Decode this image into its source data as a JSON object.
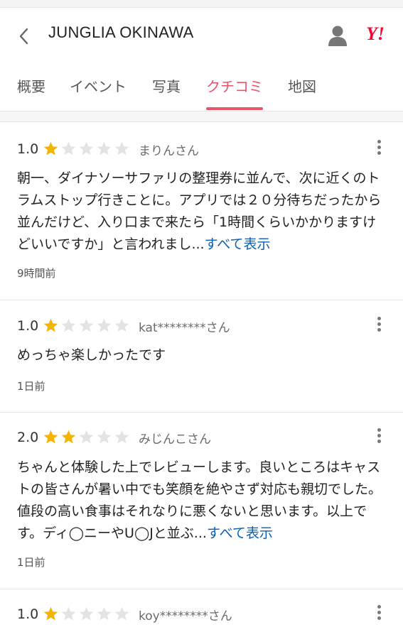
{
  "header": {
    "title": "JUNGLIA OKINAWA",
    "logo_text": "Y!"
  },
  "tabs": [
    {
      "label": "概要",
      "active": false
    },
    {
      "label": "イベント",
      "active": false
    },
    {
      "label": "写真",
      "active": false
    },
    {
      "label": "クチコミ",
      "active": true
    },
    {
      "label": "地図",
      "active": false
    }
  ],
  "colors": {
    "accent": "#e8546a",
    "star_filled": "#f5b400",
    "star_empty": "#e3e3e3",
    "link": "#0a5fb4"
  },
  "reviews": [
    {
      "score": "1.0",
      "stars_filled": 1,
      "user": "まりんさん",
      "text": "朝一、ダイナソーサファリの整理券に並んで、次に近くのトラムストップ行きことに。アプリでは２０分待ちだったから並んだけど、入り口まで来たら「1時間くらいかかりますけどいいですか」と言われまし...",
      "more": "すべて表示",
      "time": "9時間前"
    },
    {
      "score": "1.0",
      "stars_filled": 1,
      "user": "kat********さん",
      "text": "めっちゃ楽しかったです",
      "more": "",
      "time": "1日前"
    },
    {
      "score": "2.0",
      "stars_filled": 2,
      "user": "みじんこさん",
      "text": "ちゃんと体験した上でレビューします。良いところはキャストの皆さんが暑い中でも笑顔を絶やさず対応も親切でした。値段の高い食事はそれなりに悪くないと思います。以上です。ディ◯ニーやU◯Jと並ぶ...",
      "more": "すべて表示",
      "time": "1日前"
    },
    {
      "score": "1.0",
      "stars_filled": 1,
      "user": "koy********さん",
      "text": "",
      "more": "",
      "time": ""
    }
  ]
}
